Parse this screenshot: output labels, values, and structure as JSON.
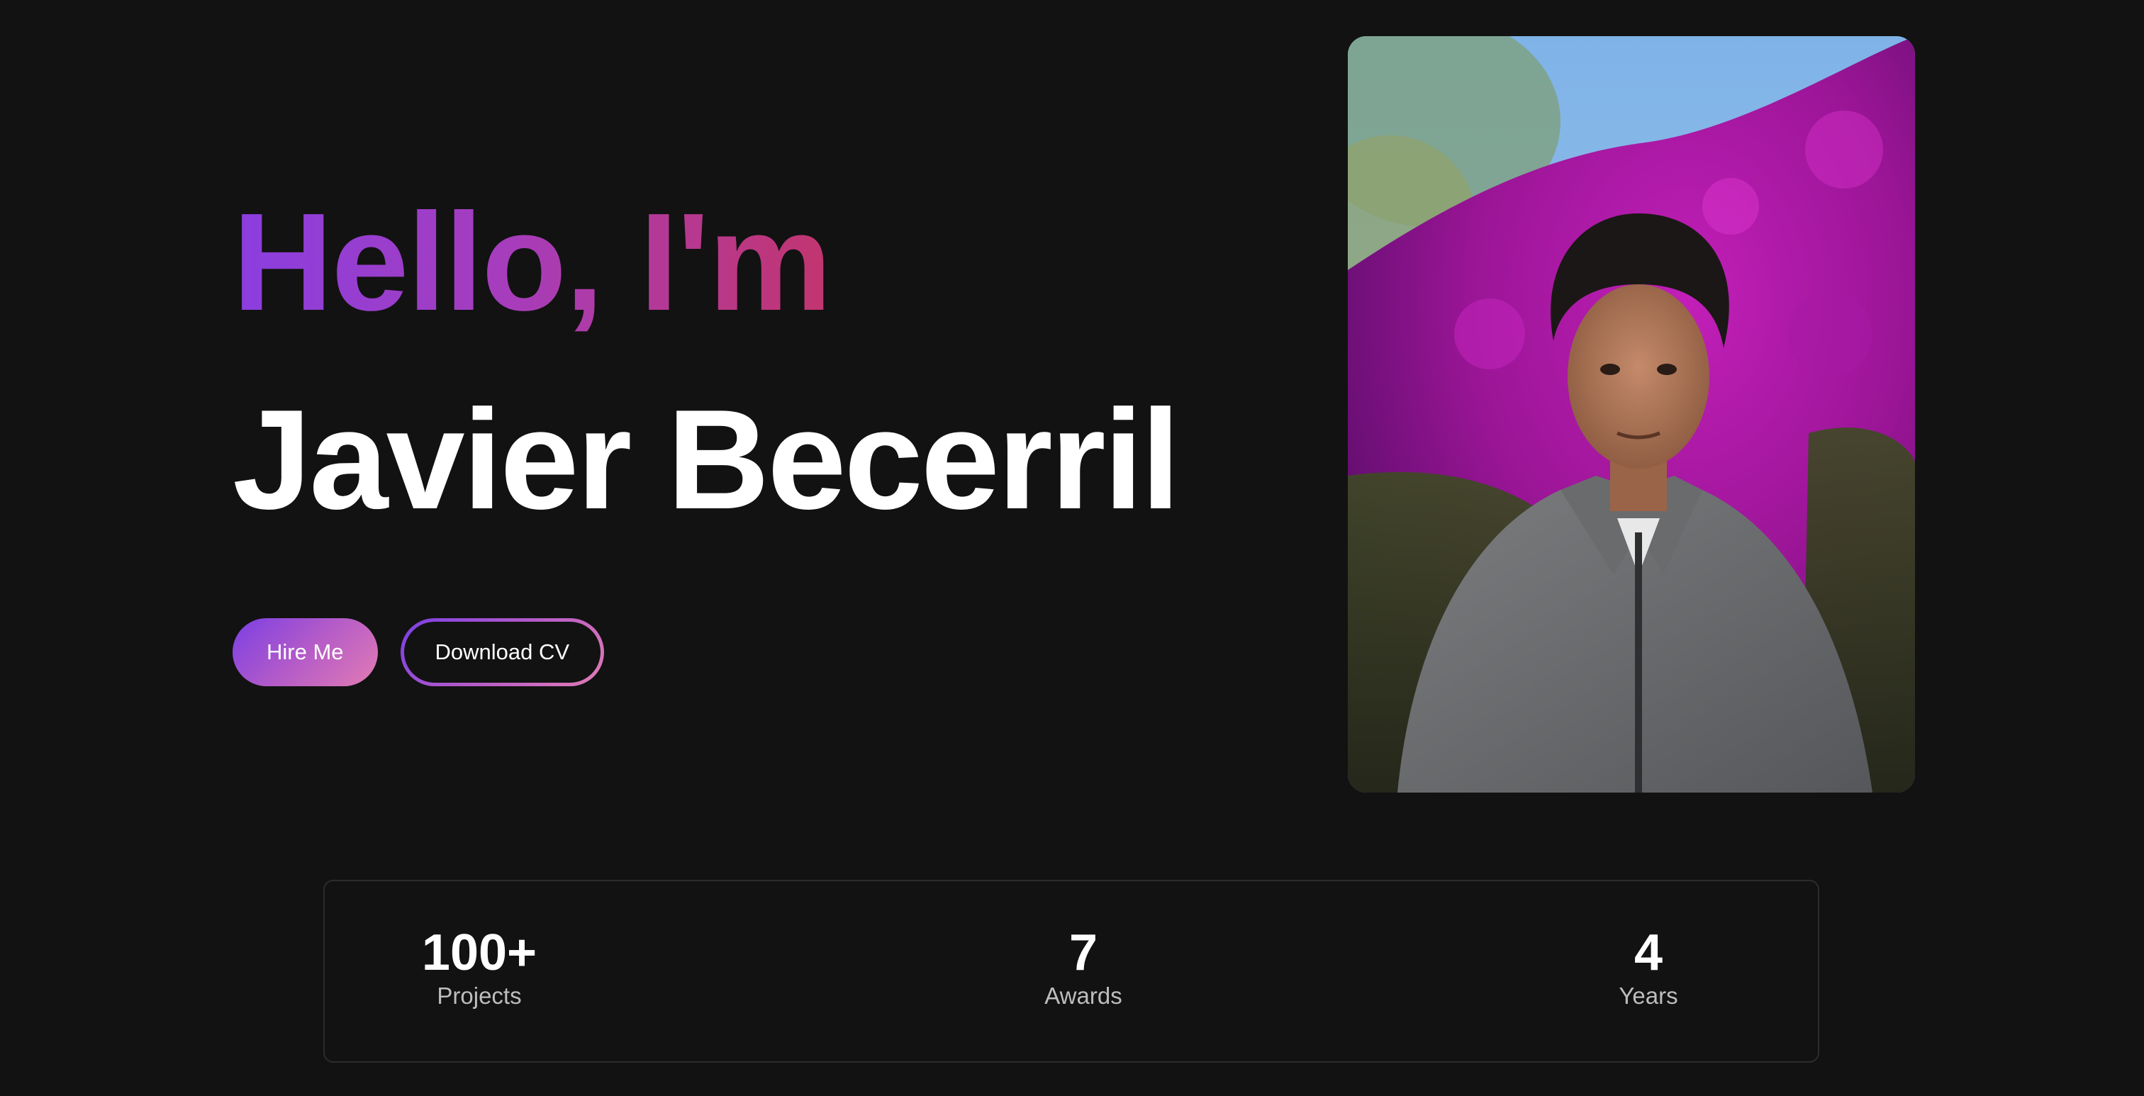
{
  "hero": {
    "greeting": "Hello, I'm",
    "name": "Javier Becerril",
    "buttons": {
      "hire": "Hire Me",
      "download": "Download CV"
    }
  },
  "photo": {
    "alt": "Portrait of Javier Becerril in front of bougainvillea"
  },
  "stats": [
    {
      "value": "100+",
      "label": "Projects"
    },
    {
      "value": "7",
      "label": "Awards"
    },
    {
      "value": "4",
      "label": "Years"
    }
  ],
  "colors": {
    "background": "#121212",
    "gradient_start": "#8a3ee0",
    "gradient_end": "#c2356e",
    "button_gradient_start": "#7b3fe4",
    "button_gradient_end": "#e27bb4",
    "text": "#ffffff",
    "muted_text": "#bdbdbd",
    "card_border": "#2c2c2c"
  }
}
